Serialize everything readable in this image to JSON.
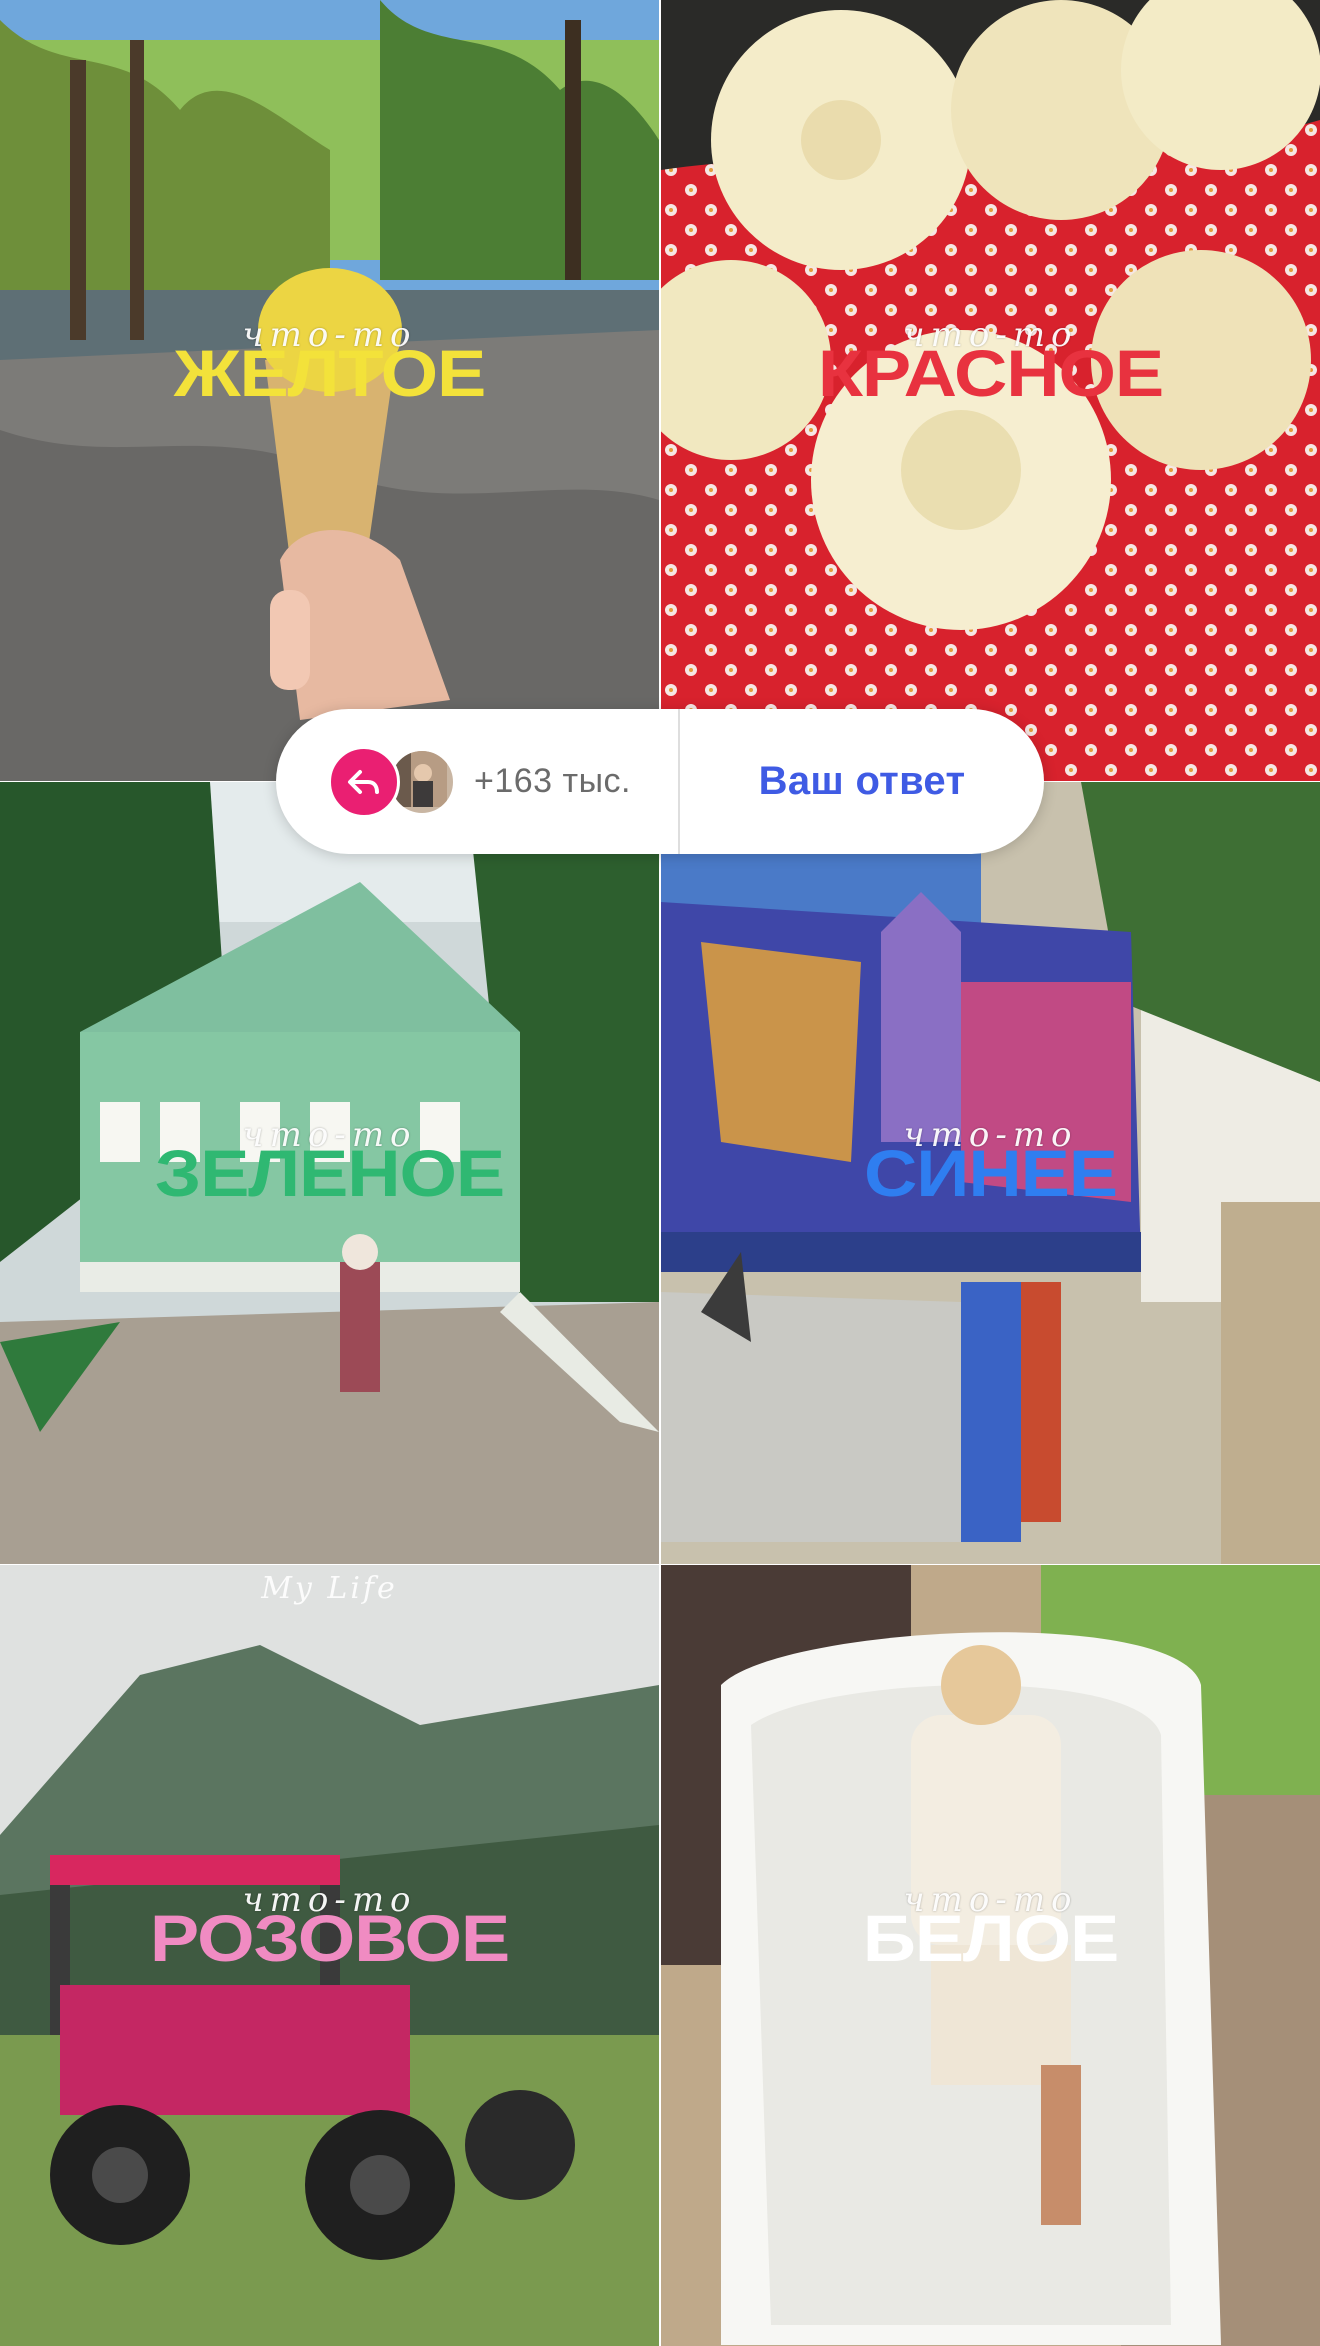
{
  "tiles": [
    {
      "script": "что-то",
      "word": "ЖЕЛТОЕ",
      "color": "#f3e23a"
    },
    {
      "script": "что-то",
      "word": "КРАСНОЕ",
      "color": "#e8323f"
    },
    {
      "script": "что-то",
      "word": "ЗЕЛЕНОЕ",
      "color": "#2fb872"
    },
    {
      "script": "что-то",
      "word": "СИНЕЕ",
      "color": "#2f7ef0"
    },
    {
      "script": "что-то",
      "word": "РОЗОВОЕ",
      "color": "#f08bc2"
    },
    {
      "script": "что-то",
      "word": "БЕЛОЕ",
      "color": "#ffffff"
    }
  ],
  "watermark": "My Life",
  "reply": {
    "count": "+163 тыс.",
    "answer_label": "Ваш ответ",
    "icon": "reply-arrow-icon",
    "accent": "#ea1f72",
    "link_color": "#3f5be4"
  }
}
